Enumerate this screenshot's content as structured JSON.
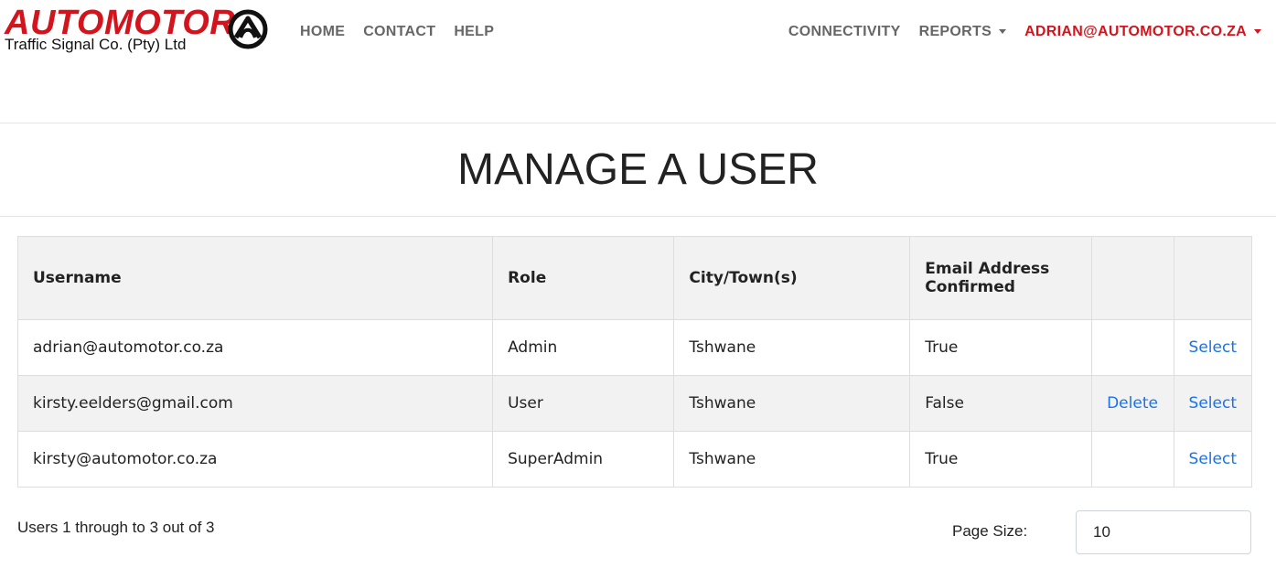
{
  "brand": {
    "name": "AUTOMOTOR",
    "subtitle": "Traffic Signal Co. (Pty) Ltd",
    "color": "#d3141c"
  },
  "nav": {
    "left": [
      "HOME",
      "CONTACT",
      "HELP"
    ],
    "connectivity": "CONNECTIVITY",
    "reports": "REPORTS",
    "user": "ADRIAN@AUTOMOTOR.CO.ZA"
  },
  "page": {
    "title": "MANAGE A USER"
  },
  "table": {
    "headers": {
      "username": "Username",
      "role": "Role",
      "city": "City/Town(s)",
      "confirmed": "Email Address Confirmed"
    },
    "rows": [
      {
        "username": "adrian@automotor.co.za",
        "role": "Admin",
        "city": "Tshwane",
        "confirmed": "True",
        "delete": "",
        "select": "Select"
      },
      {
        "username": "kirsty.eelders@gmail.com",
        "role": "User",
        "city": "Tshwane",
        "confirmed": "False",
        "delete": "Delete",
        "select": "Select"
      },
      {
        "username": "kirsty@automotor.co.za",
        "role": "SuperAdmin",
        "city": "Tshwane",
        "confirmed": "True",
        "delete": "",
        "select": "Select"
      }
    ],
    "link_color": "#1a73e8"
  },
  "footer": {
    "summary": "Users 1 through to 3 out of 3",
    "page_size_label": "Page Size:",
    "page_size_value": "10"
  }
}
